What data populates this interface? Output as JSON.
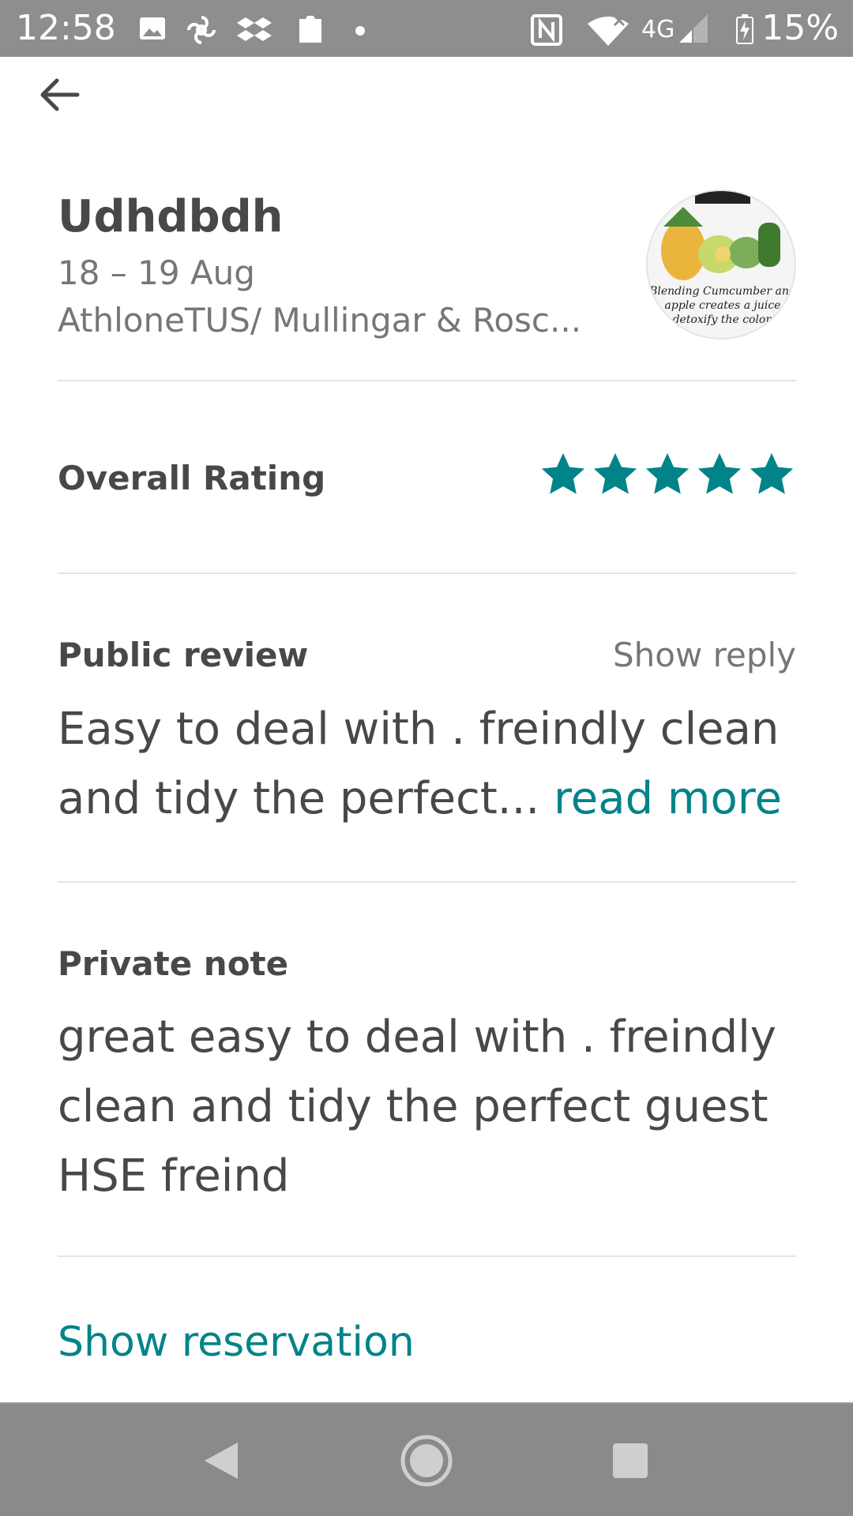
{
  "status_bar": {
    "time": "12:58",
    "network": "4G",
    "battery": "15%"
  },
  "listing": {
    "title": "Udhdbdh",
    "dates": "18 – 19 Aug",
    "location": "AthloneTUS/ Mullingar & Rosc...",
    "photo_caption": [
      "Blending Cumcumber and",
      "apple creates a juice",
      "detoxify the colon"
    ]
  },
  "rating": {
    "label": "Overall Rating",
    "stars": 5,
    "star_color": "#008489"
  },
  "public_review": {
    "label": "Public review",
    "show_reply": "Show reply",
    "text": "Easy to deal with . freindly clean and tidy the perfect...",
    "read_more": "read more"
  },
  "private_note": {
    "label": "Private note",
    "text": "great easy to deal with . freindly clean and tidy the perfect guest HSE freind"
  },
  "actions": {
    "show_reservation": "Show reservation"
  },
  "colors": {
    "accent": "#008489",
    "text": "#484848",
    "muted": "#767676"
  }
}
